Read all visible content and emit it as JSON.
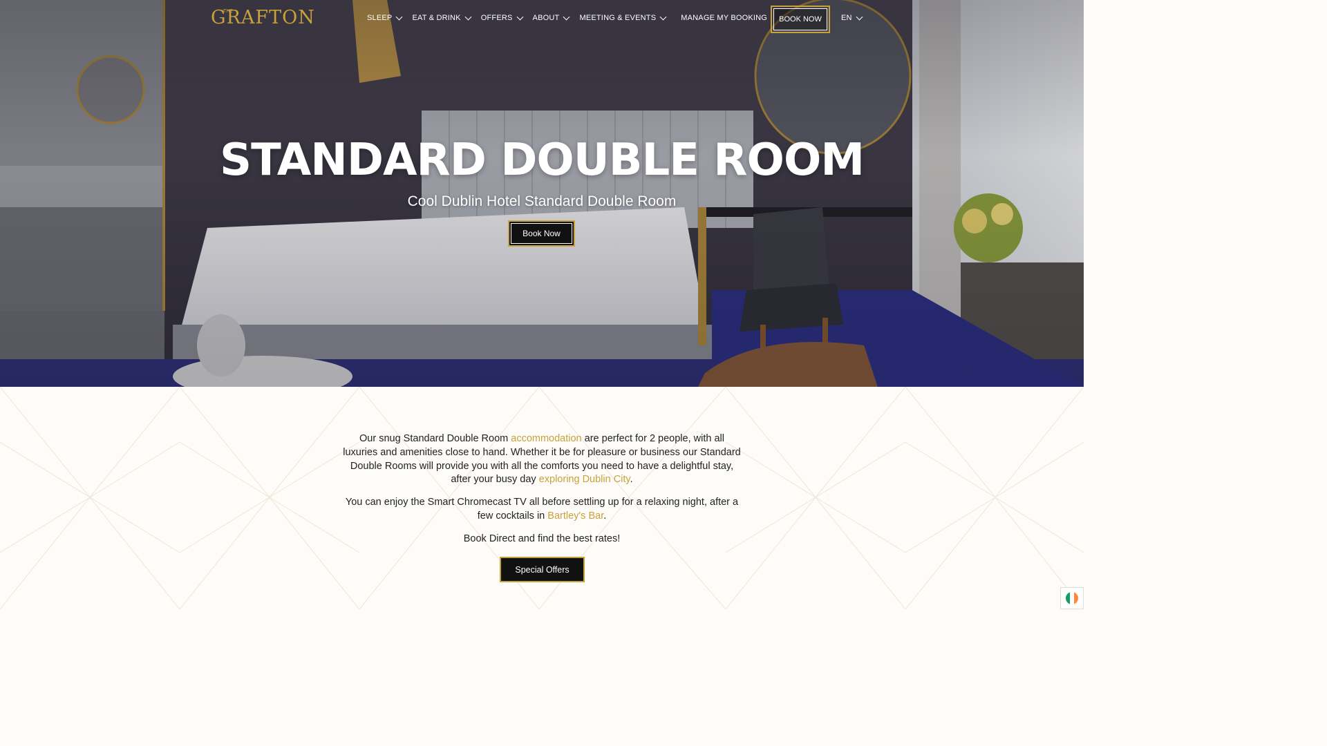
{
  "brand": {
    "the": "THE",
    "name": "GRAFTON",
    "color": "#c9a13a"
  },
  "nav": {
    "items": [
      {
        "label": "SLEEP",
        "dropdown": true
      },
      {
        "label": "EAT & DRINK",
        "dropdown": true
      },
      {
        "label": "OFFERS",
        "dropdown": true
      },
      {
        "label": "ABOUT",
        "dropdown": true
      },
      {
        "label": "MEETING & EVENTS",
        "dropdown": true
      },
      {
        "label": "MANAGE MY BOOKING",
        "dropdown": false
      }
    ],
    "book_now": "BOOK NOW",
    "language": "EN"
  },
  "hero": {
    "title": "STANDARD DOUBLE ROOM",
    "subtitle": "Cool Dublin Hotel Standard Double Room",
    "button": "Book Now"
  },
  "content": {
    "p1": {
      "before": "Our snug Standard Double Room ",
      "link1": "accommodation",
      "middle": " are perfect for 2 people, with all luxuries and amenities close to hand. Whether it be for pleasure or business our Standard Double Rooms will provide you with all the comforts you need to have a delightful stay, after your busy day ",
      "link2": "exploring Dublin City",
      "after": "."
    },
    "p2": {
      "before": "You can enjoy the Smart Chromecast TV all before settling up for a relaxing night, after a few cocktails in ",
      "link": "Bartley's Bar",
      "after": "."
    },
    "p3": "Book Direct and find the best rates!",
    "button": "Special Offers"
  },
  "colors": {
    "accent": "#c9a13a",
    "dark": "#111111",
    "text": "#222222"
  },
  "icons": {
    "chevron": "chevron-down-icon",
    "flag": "ireland-flag-icon"
  }
}
